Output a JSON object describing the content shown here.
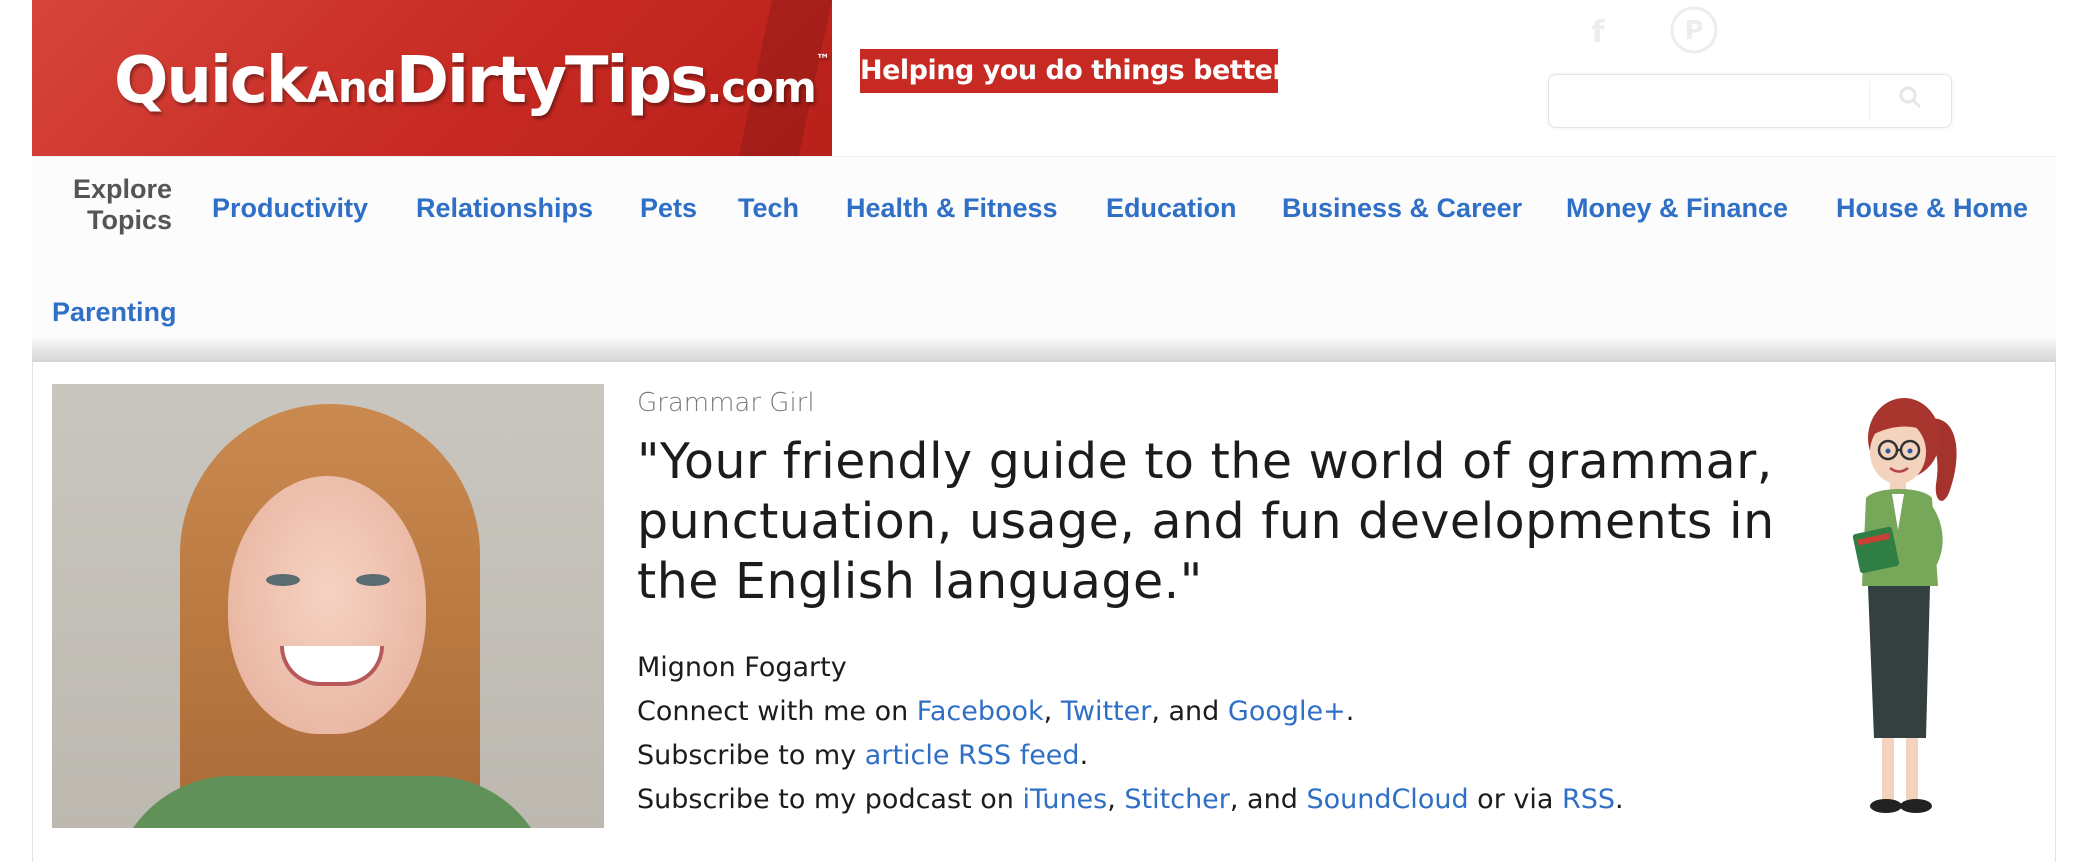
{
  "header": {
    "logo": {
      "quick": "Quick",
      "and": "And",
      "dirty": "Dirty",
      "tips": "Tips",
      "com": ".com",
      "tm": "™"
    },
    "tagline": "Helping you do things better.",
    "search": {
      "placeholder": ""
    }
  },
  "nav": {
    "explore_label_line1": "Explore",
    "explore_label_line2": "Topics",
    "links": [
      "Productivity",
      "Relationships",
      "Pets",
      "Tech",
      "Health & Fitness",
      "Education",
      "Business & Career",
      "Money & Finance",
      "House & Home",
      "Parenting"
    ]
  },
  "profile": {
    "show_name": "Grammar Girl",
    "quote": "\"Your friendly guide to the world of grammar, punctuation, usage, and fun developments in the English language.\"",
    "author": "Mignon Fogarty",
    "connect": {
      "prefix": "Connect with me on ",
      "facebook": "Facebook",
      "sep1": ", ",
      "twitter": "Twitter",
      "sep2": ", and ",
      "google": "Google+",
      "end": "."
    },
    "subscribe_article": {
      "prefix": "Subscribe to my ",
      "link": "article RSS feed",
      "end": "."
    },
    "subscribe_podcast": {
      "prefix": "Subscribe to my podcast on ",
      "itunes": "iTunes",
      "sep1": ", ",
      "stitcher": "Stitcher",
      "sep2": ", and ",
      "soundcloud": "SoundCloud",
      "mid": " or via ",
      "rss": "RSS",
      "end": "."
    }
  },
  "colors": {
    "brand_red": "#c72a22",
    "link_blue": "#2f6fc6",
    "nav_gray": "#555555"
  },
  "icons": [
    "facebook-icon",
    "pinterest-icon",
    "search-icon"
  ]
}
